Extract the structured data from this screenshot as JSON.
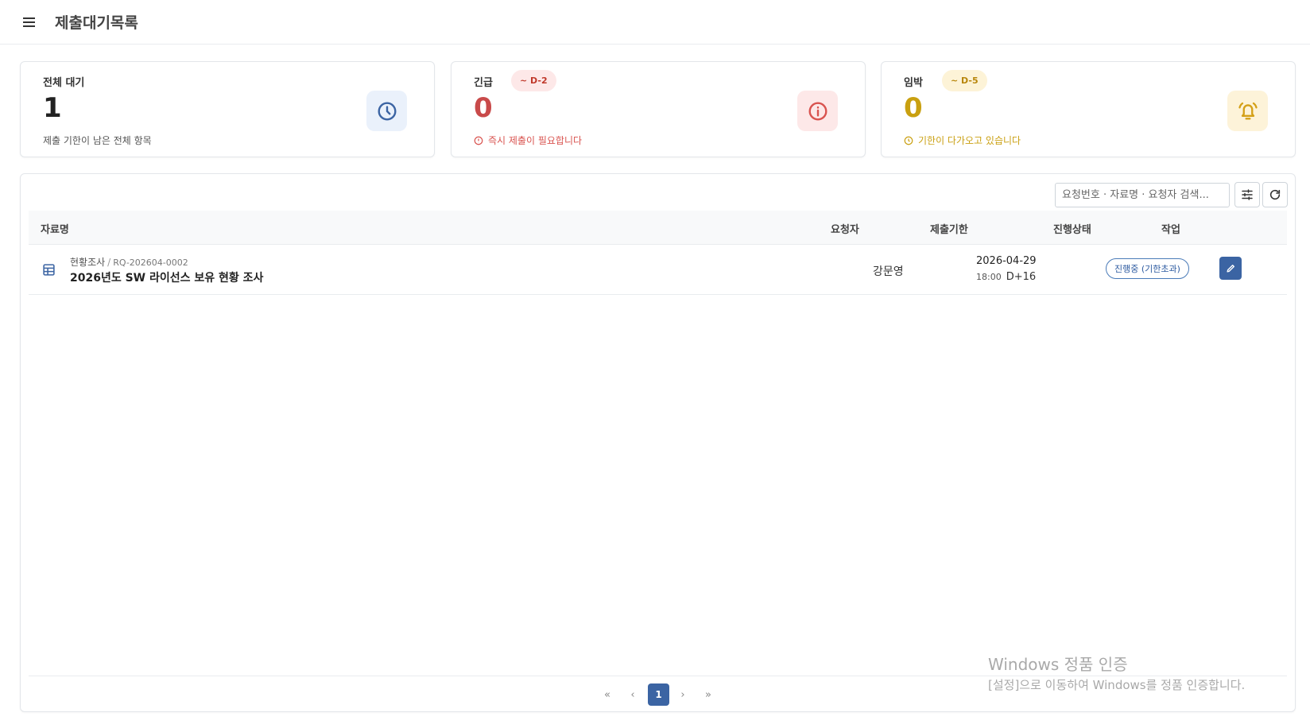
{
  "header": {
    "title": "제출대기목록"
  },
  "cards": [
    {
      "label": "전체 대기",
      "badge": "",
      "value": "1",
      "sub": "제출 기한이 남은 전체 항목"
    },
    {
      "label": "긴급",
      "badge": "~ D-2",
      "value": "0",
      "sub": "즉시 제출이 필요합니다"
    },
    {
      "label": "임박",
      "badge": "~ D-5",
      "value": "0",
      "sub": "기한이 다가오고 있습니다"
    }
  ],
  "colors": {
    "accent": "#3b64a3",
    "urgent": "#c94a4a",
    "imminent": "#c9a010"
  },
  "toolbar": {
    "search_placeholder": "요청번호 · 자료명 · 요청자 검색..."
  },
  "table": {
    "columns": [
      "자료명",
      "요청자",
      "제출기한",
      "진행상태",
      "작업"
    ],
    "rows": [
      {
        "category": "현황조사",
        "code": "RQ-202604-0002",
        "title": "2026년도 SW 라이선스 보유 현황 조사",
        "requester": "강문영",
        "date": "2026-04-29",
        "time": "18:00",
        "dday": "D+16",
        "status": "진행중 (기한초과)"
      }
    ]
  },
  "pagination": {
    "first": "«",
    "prev": "‹",
    "current": "1",
    "next": "›",
    "last": "»"
  },
  "watermark": {
    "line1": "Windows 정품 인증",
    "line2": "[설정]으로 이동하여 Windows를 정품 인증합니다."
  }
}
